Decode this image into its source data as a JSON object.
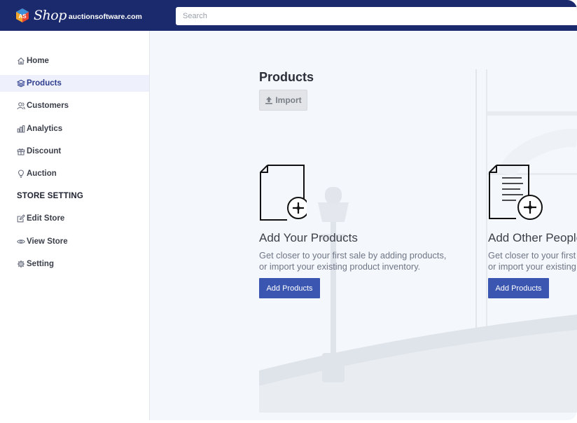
{
  "brand": {
    "name": "Shop",
    "domain": "auctionsoftware.com"
  },
  "search": {
    "placeholder": "Search"
  },
  "sidebar": {
    "items": [
      {
        "label": "Home",
        "icon": "home-icon"
      },
      {
        "label": "Products",
        "icon": "layers-icon",
        "active": true
      },
      {
        "label": "Customers",
        "icon": "users-icon"
      },
      {
        "label": "Analytics",
        "icon": "bar-chart-icon"
      },
      {
        "label": "Discount",
        "icon": "gift-icon"
      },
      {
        "label": "Auction",
        "icon": "lightbulb-icon"
      }
    ],
    "section_heading": "STORE SETTING",
    "settings_items": [
      {
        "label": "Edit Store",
        "icon": "edit-icon"
      },
      {
        "label": "View Store",
        "icon": "eye-icon"
      },
      {
        "label": "Setting",
        "icon": "gear-icon"
      }
    ]
  },
  "main": {
    "title": "Products",
    "import_label": "Import",
    "cards": [
      {
        "title": "Add Your Products",
        "desc_line1": "Get closer to your first sale by adding products,",
        "desc_line2": "or import your existing product inventory.",
        "button": "Add Products",
        "icon": "document-add-icon"
      },
      {
        "title": "Add Other People's Products",
        "desc_line1": "Get closer to your first sale by adding products,",
        "desc_line2": "or import your existing product inventory.",
        "button": "Add Products",
        "icon": "document-lines-add-icon"
      }
    ]
  },
  "colors": {
    "topbar": "#1a2a6c",
    "accent": "#3a56b0",
    "active_nav_bg": "#eef1fb",
    "main_bg": "#f4f8fc"
  }
}
